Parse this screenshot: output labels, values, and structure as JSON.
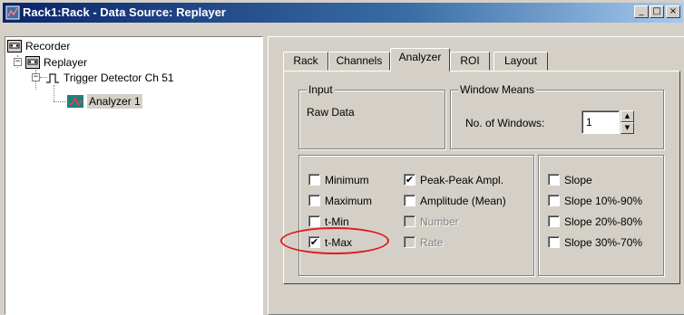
{
  "window": {
    "title": "Rack1:Rack - Data Source: Replayer",
    "min": "_",
    "max": "□",
    "close": "×"
  },
  "tree": {
    "recorder": "Recorder",
    "replayer": "Replayer",
    "trigger": "Trigger Detector Ch 51",
    "analyzer": "Analyzer 1",
    "expander_minus": "−"
  },
  "tabs": [
    "Rack",
    "Channels",
    "Analyzer",
    "ROI",
    "Layout"
  ],
  "input_group": {
    "title": "Input",
    "value": "Raw Data"
  },
  "window_means": {
    "title": "Window Means",
    "label": "No. of Windows:",
    "value": "1",
    "up": "▲",
    "down": "▼"
  },
  "checks": {
    "minimum": {
      "label": "Minimum",
      "mark": ""
    },
    "maximum": {
      "label": "Maximum",
      "mark": ""
    },
    "tmin": {
      "label": "t-Min",
      "mark": ""
    },
    "tmax": {
      "label": "t-Max",
      "mark": "✔"
    },
    "peak": {
      "label": "Peak-Peak Ampl.",
      "mark": "✔"
    },
    "amplitude": {
      "label": "Amplitude (Mean)",
      "mark": ""
    },
    "number": {
      "label": "Number",
      "mark": ""
    },
    "rate": {
      "label": "Rate",
      "mark": ""
    },
    "slope": {
      "label": "Slope",
      "mark": ""
    },
    "slope1090": {
      "label": "Slope 10%-90%",
      "mark": ""
    },
    "slope2080": {
      "label": "Slope 20%-80%",
      "mark": ""
    },
    "slope3070": {
      "label": "Slope 30%-70%",
      "mark": ""
    }
  }
}
